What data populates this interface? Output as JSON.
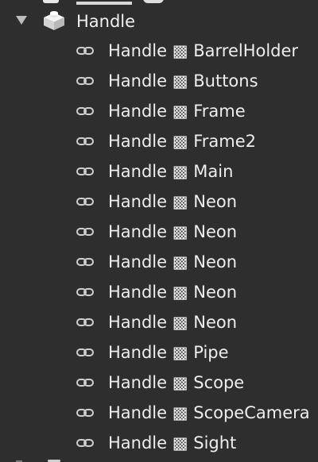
{
  "tree": {
    "parent": {
      "label": "Handle",
      "icon": "part-brick-icon",
      "expanded": true
    },
    "children": [
      {
        "label": "Handle ▩ BarrelHolder",
        "icon": "weld-link-icon"
      },
      {
        "label": "Handle ▩ Buttons",
        "icon": "weld-link-icon"
      },
      {
        "label": "Handle ▩ Frame",
        "icon": "weld-link-icon"
      },
      {
        "label": "Handle ▩ Frame2",
        "icon": "weld-link-icon"
      },
      {
        "label": "Handle ▩ Main",
        "icon": "weld-link-icon"
      },
      {
        "label": "Handle ▩ Neon",
        "icon": "weld-link-icon"
      },
      {
        "label": "Handle ▩ Neon",
        "icon": "weld-link-icon"
      },
      {
        "label": "Handle ▩ Neon",
        "icon": "weld-link-icon"
      },
      {
        "label": "Handle ▩ Neon",
        "icon": "weld-link-icon"
      },
      {
        "label": "Handle ▩ Neon",
        "icon": "weld-link-icon"
      },
      {
        "label": "Handle ▩ Pipe",
        "icon": "weld-link-icon"
      },
      {
        "label": "Handle ▩ Scope",
        "icon": "weld-link-icon"
      },
      {
        "label": "Handle ▩ ScopeCamera",
        "icon": "weld-link-icon"
      },
      {
        "label": "Handle ▩ Sight",
        "icon": "weld-link-icon"
      }
    ]
  },
  "colors": {
    "background": "#2e2e2e",
    "text": "#eeeeee",
    "caret": "#bdbdbd",
    "icon": "#cfcfcf"
  }
}
